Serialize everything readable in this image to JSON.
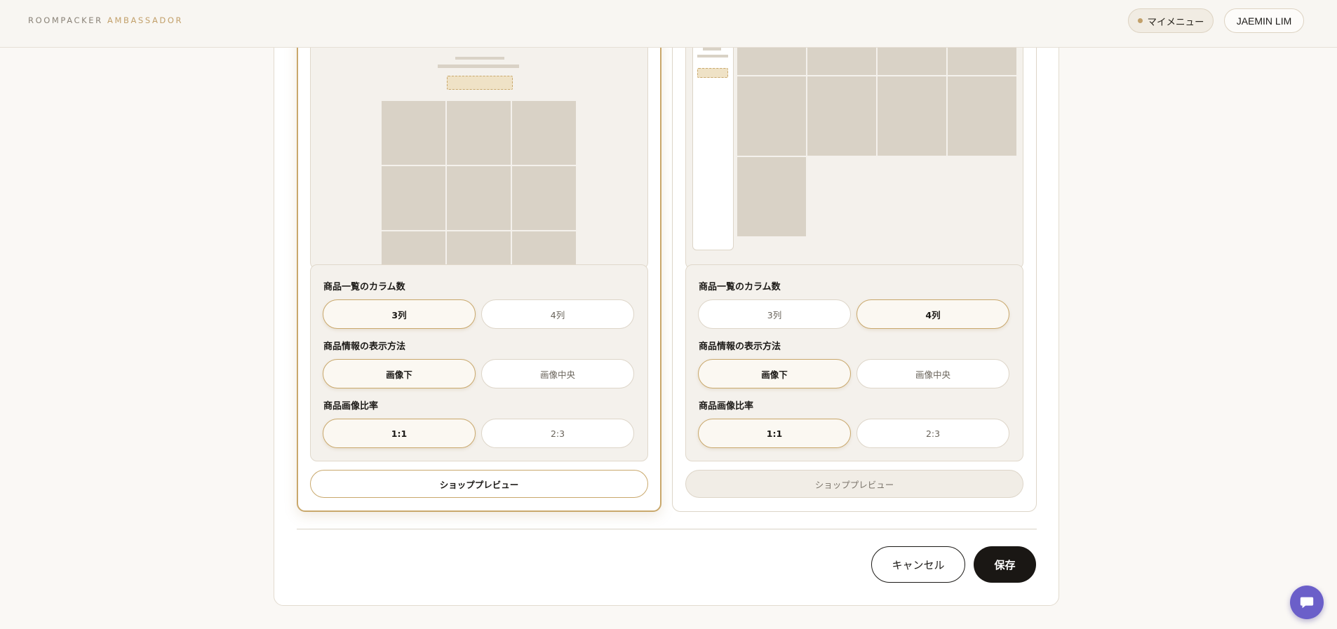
{
  "header": {
    "brand_main": "ROOMPACKER",
    "brand_accent": "AMBASSADOR",
    "menu_label": "マイメニュー",
    "user_label": "JAEMIN LIM"
  },
  "layouts": [
    {
      "selected": true,
      "settings": {
        "columns": {
          "label": "商品一覧のカラム数",
          "options": [
            "3列",
            "4列"
          ],
          "selected": "3列"
        },
        "info_display": {
          "label": "商品情報の表示方法",
          "options": [
            "画像下",
            "画像中央"
          ],
          "selected": "画像下"
        },
        "image_ratio": {
          "label": "商品画像比率",
          "options": [
            "1:1",
            "2:3"
          ],
          "selected": "1:1"
        }
      },
      "preview_button": "ショッププレビュー"
    },
    {
      "selected": false,
      "settings": {
        "columns": {
          "label": "商品一覧のカラム数",
          "options": [
            "3列",
            "4列"
          ],
          "selected": "4列"
        },
        "info_display": {
          "label": "商品情報の表示方法",
          "options": [
            "画像下",
            "画像中央"
          ],
          "selected": "画像下"
        },
        "image_ratio": {
          "label": "商品画像比率",
          "options": [
            "1:1",
            "2:3"
          ],
          "selected": "1:1"
        }
      },
      "preview_button": "ショッププレビュー"
    }
  ],
  "actions": {
    "cancel": "キャンセル",
    "save": "保存"
  },
  "icons": {
    "chat": "chat-bubble-icon",
    "menu_dot": "status-dot-icon"
  },
  "colors": {
    "accent": "#c9a86c",
    "dark": "#1a1714",
    "chat": "#6b5fc9"
  }
}
